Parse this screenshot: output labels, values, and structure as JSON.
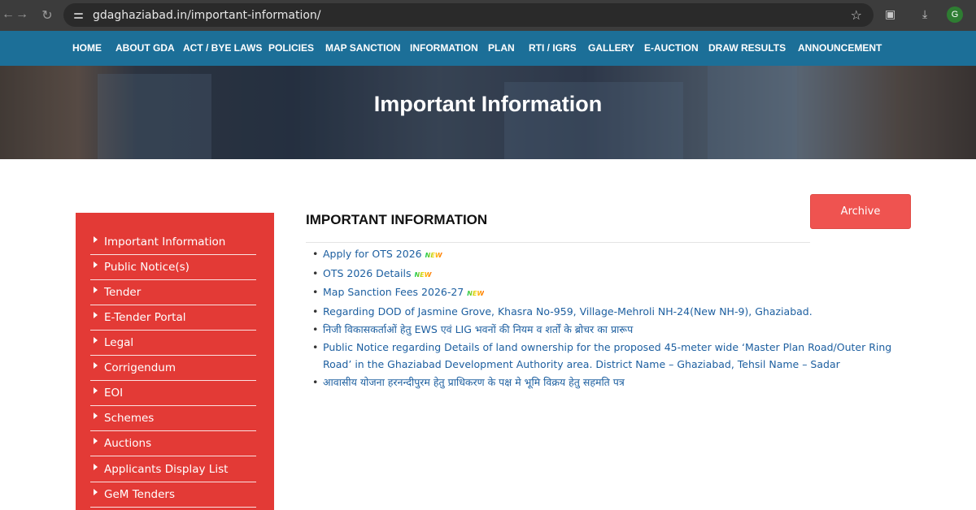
{
  "browser": {
    "url": "gdaghaziabad.in/important-information/",
    "profile_initial": "G"
  },
  "nav": {
    "items": [
      "HOME",
      "ABOUT GDA",
      "ACT / BYE LAWS",
      "POLICIES",
      "MAP SANCTION",
      "INFORMATION",
      "PLAN",
      "RTI / IGRS",
      "GALLERY",
      "E-AUCTION",
      "DRAW RESULTS",
      "ANNOUNCEMENT"
    ]
  },
  "banner": {
    "title": "Important Information"
  },
  "sidebar": {
    "items": [
      "Important Information",
      "Public Notice(s)",
      "Tender",
      "E-Tender Portal",
      "Legal",
      "Corrigendum",
      "EOI",
      "Schemes",
      "Auctions",
      "Applicants Display List",
      "GeM Tenders"
    ]
  },
  "main": {
    "heading": "IMPORTANT INFORMATION",
    "archive_label": "Archive",
    "new_badge": "NEW",
    "items": [
      "Apply for OTS 2026",
      "OTS 2026 Details",
      "Map Sanction Fees 2026-27",
      "Regarding DOD of Jasmine Grove, Khasra No-959, Village-Mehroli NH-24(New NH-9), Ghaziabad.",
      "निजी विकासकर्ताओं हेतु EWS एवं LIG भवनों की नियम व शर्तों के ब्रोचर का प्रारूप",
      "Public Notice regarding Details of land ownership for the proposed 45-meter wide ‘Master Plan Road/Outer Ring Road’ in the Ghaziabad Development Authority area. District Name – Ghaziabad, Tehsil Name – Sadar",
      "आवासीय योजना हरनन्दीपुरम हेतु प्राधिकरण के पक्ष मे भूमि विक्रय हेतु सहमति पत्र"
    ]
  },
  "colors": {
    "nav_bg": "#1c6f98",
    "sidebar_bg": "#e33a36",
    "archive_bg": "#ef5350",
    "link": "#1d5fa0"
  }
}
